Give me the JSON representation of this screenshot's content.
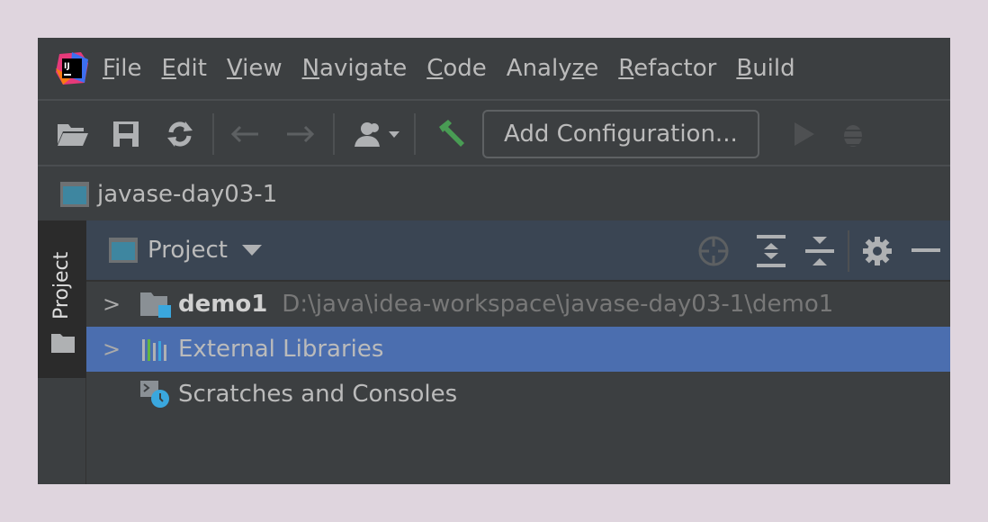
{
  "menubar": {
    "items": [
      {
        "pre": "",
        "key": "F",
        "post": "ile"
      },
      {
        "pre": "",
        "key": "E",
        "post": "dit"
      },
      {
        "pre": "",
        "key": "V",
        "post": "iew"
      },
      {
        "pre": "",
        "key": "N",
        "post": "avigate"
      },
      {
        "pre": "",
        "key": "C",
        "post": "ode"
      },
      {
        "pre": "Analy",
        "key": "z",
        "post": "e"
      },
      {
        "pre": "",
        "key": "R",
        "post": "efactor"
      },
      {
        "pre": "",
        "key": "B",
        "post": "uild"
      }
    ],
    "logo_text": "IJ"
  },
  "toolbar": {
    "add_configuration": "Add Configuration..."
  },
  "breadcrumb": {
    "project": "javase-day03-1"
  },
  "strip": {
    "project_tab": "Project"
  },
  "panel": {
    "title": "Project",
    "tree": [
      {
        "name": "demo1",
        "path": "D:\\java\\idea-workspace\\javase-day03-1\\demo1"
      },
      {
        "name": "External Libraries"
      },
      {
        "name": "Scratches and Consoles"
      }
    ]
  },
  "colors": {
    "selection": "#4b6eaf",
    "accent_blue": "#3aa7de",
    "build_green": "#499c54"
  }
}
